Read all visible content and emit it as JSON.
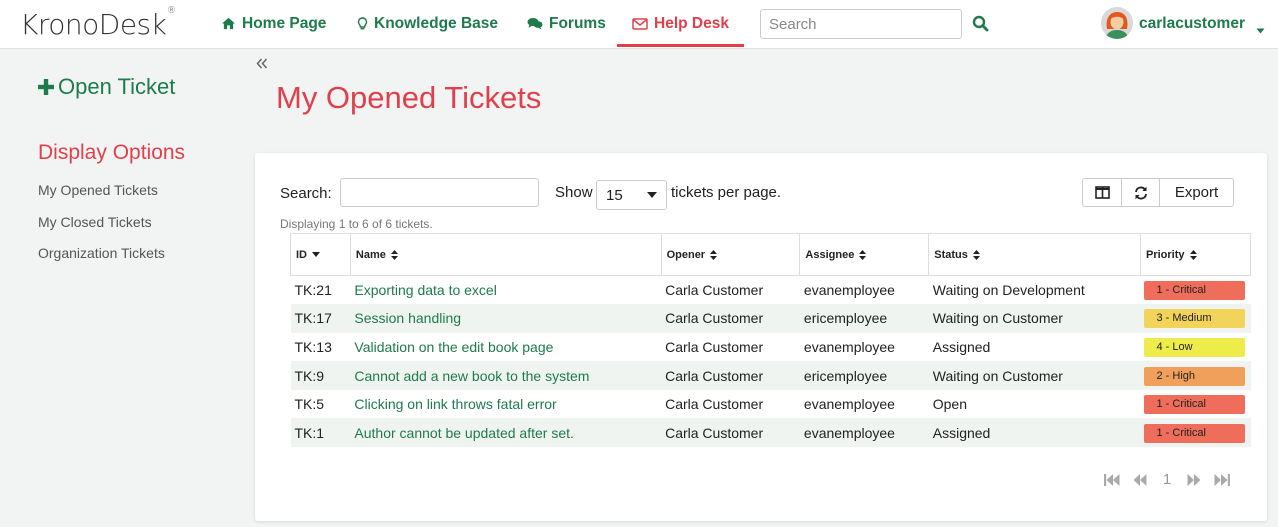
{
  "header": {
    "logo_text": "KronoDesk",
    "logo_mark": "®",
    "nav": [
      {
        "label": "Home Page",
        "icon": "home-icon"
      },
      {
        "label": "Knowledge Base",
        "icon": "lightbulb-icon"
      },
      {
        "label": "Forums",
        "icon": "comments-icon"
      },
      {
        "label": "Help Desk",
        "icon": "envelope-icon",
        "active": true
      }
    ],
    "search_placeholder": "Search",
    "username": "carlacustomer"
  },
  "sidebar": {
    "open_ticket": "Open Ticket",
    "display_options": "Display Options",
    "links": [
      "My Opened Tickets",
      "My Closed Tickets",
      "Organization Tickets"
    ]
  },
  "main": {
    "title": "My Opened Tickets",
    "search_label": "Search:",
    "show_label": "Show",
    "per_page_value": "15",
    "per_page_suffix": "tickets per page.",
    "export_label": "Export",
    "displaying": "Displaying 1 to 6 of 6 tickets.",
    "columns": [
      "ID",
      "Name",
      "Opener",
      "Assignee",
      "Status",
      "Priority"
    ],
    "rows": [
      {
        "id": "TK:21",
        "name": "Exporting data to excel",
        "opener": "Carla Customer",
        "assignee": "evanemployee",
        "status": "Waiting on Development",
        "priority": "1 - Critical"
      },
      {
        "id": "TK:17",
        "name": "Session handling",
        "opener": "Carla Customer",
        "assignee": "ericemployee",
        "status": "Waiting on Customer",
        "priority": "3 - Medium"
      },
      {
        "id": "TK:13",
        "name": "Validation on the edit book page",
        "opener": "Carla Customer",
        "assignee": "evanemployee",
        "status": "Assigned",
        "priority": "4 - Low"
      },
      {
        "id": "TK:9",
        "name": "Cannot add a new book to the system",
        "opener": "Carla Customer",
        "assignee": "ericemployee",
        "status": "Waiting on Customer",
        "priority": "2 - High"
      },
      {
        "id": "TK:5",
        "name": "Clicking on link throws fatal error",
        "opener": "Carla Customer",
        "assignee": "evanemployee",
        "status": "Open",
        "priority": "1 - Critical"
      },
      {
        "id": "TK:1",
        "name": "Author cannot be updated after set.",
        "opener": "Carla Customer",
        "assignee": "evanemployee",
        "status": "Assigned",
        "priority": "1 - Critical"
      }
    ],
    "pagination_page": "1"
  },
  "colors": {
    "accent_green": "#1e7b4b",
    "accent_red": "#e0404b",
    "priority_critical": "#ee6d5b",
    "priority_high": "#f0a05a",
    "priority_medium": "#f3d45a",
    "priority_low": "#eeec4a"
  }
}
